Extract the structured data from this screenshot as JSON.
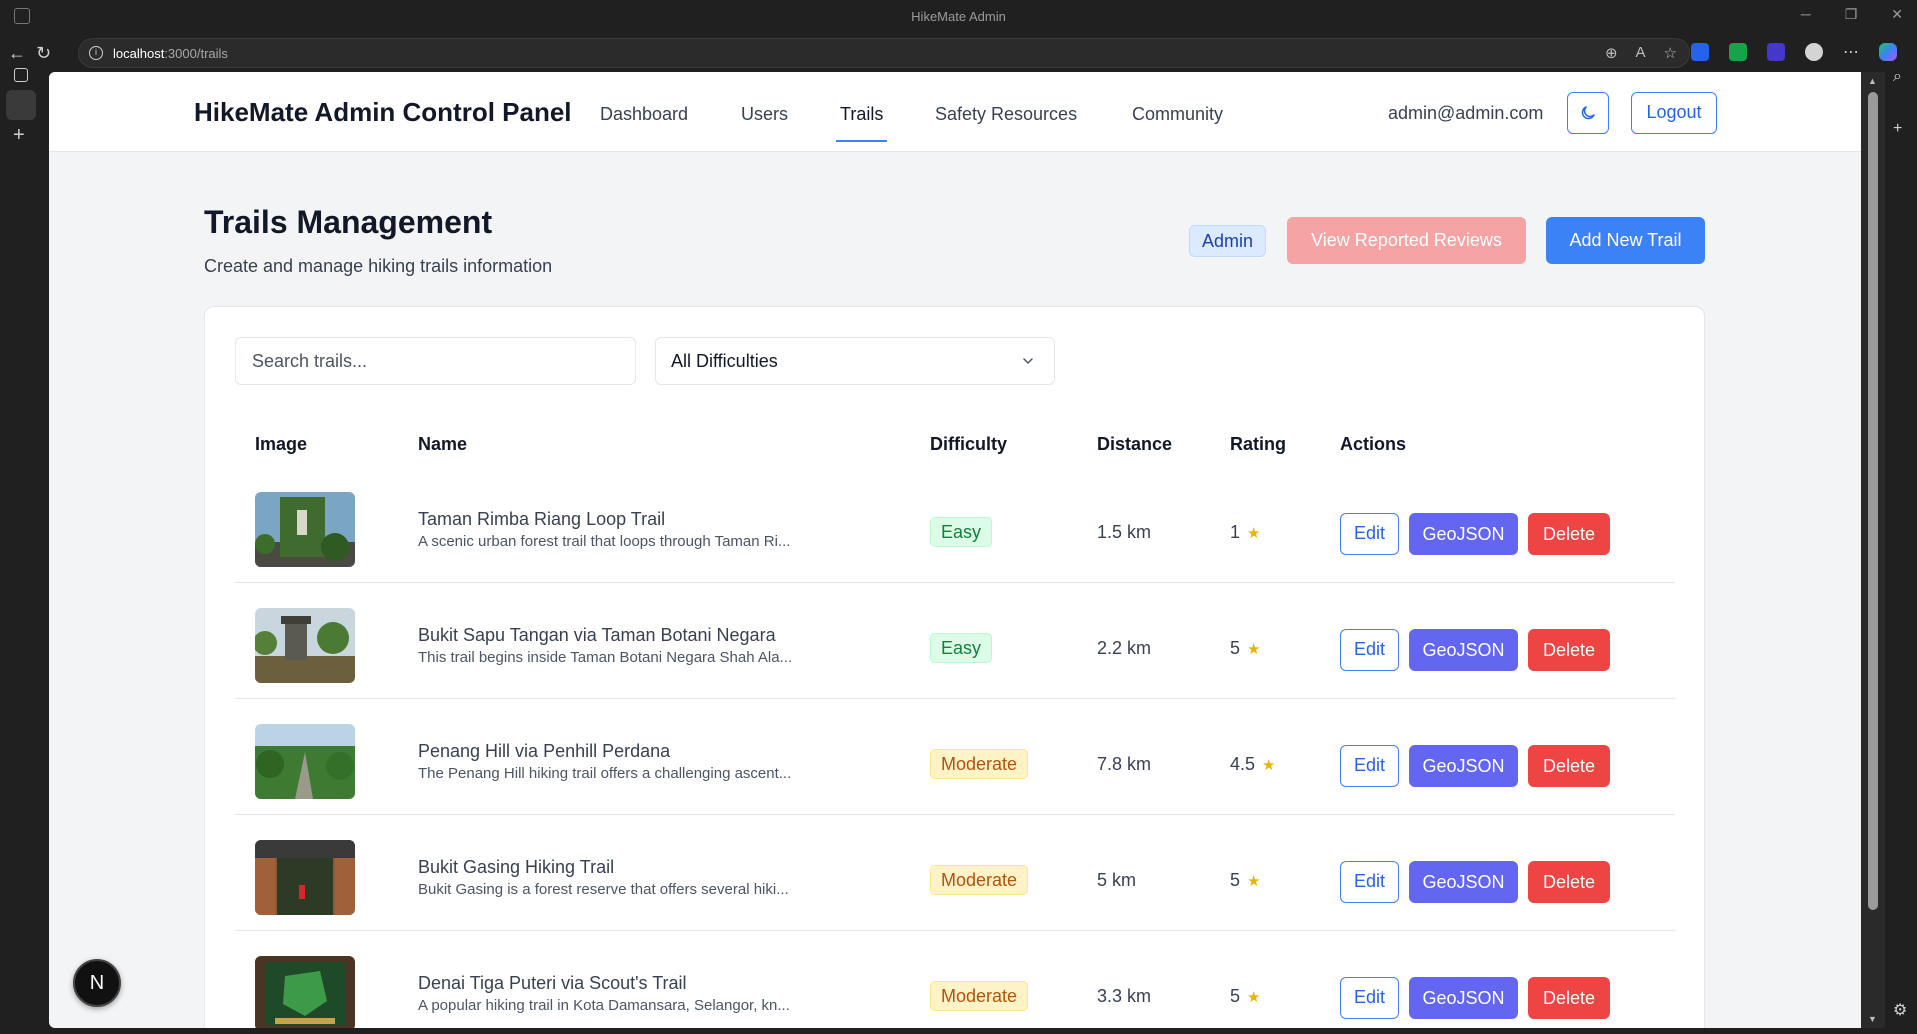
{
  "browser": {
    "window_title": "HikeMate Admin",
    "url_host": "localhost",
    "url_path": ":3000/trails"
  },
  "nav": {
    "brand": "HikeMate Admin Control Panel",
    "links": [
      "Dashboard",
      "Users",
      "Trails",
      "Safety Resources",
      "Community"
    ],
    "active": "Trails",
    "user_email": "admin@admin.com",
    "logout": "Logout"
  },
  "page": {
    "title": "Trails Management",
    "subtitle": "Create and manage hiking trails information",
    "role_badge": "Admin",
    "view_reported": "View Reported Reviews",
    "add_trail": "Add New Trail"
  },
  "filters": {
    "search_placeholder": "Search trails...",
    "difficulty_selected": "All Difficulties"
  },
  "table": {
    "headers": [
      "Image",
      "Name",
      "Difficulty",
      "Distance",
      "Rating",
      "Actions"
    ],
    "rows": [
      {
        "name": "Taman Rimba Riang Loop Trail",
        "desc": "A scenic urban forest trail that loops through Taman Ri...",
        "difficulty": "Easy",
        "distance": "1.5 km",
        "rating": "1"
      },
      {
        "name": "Bukit Sapu Tangan via Taman Botani Negara",
        "desc": "This trail begins inside Taman Botani Negara Shah Ala...",
        "difficulty": "Easy",
        "distance": "2.2 km",
        "rating": "5"
      },
      {
        "name": "Penang Hill via Penhill Perdana",
        "desc": "The Penang Hill hiking trail offers a challenging ascent...",
        "difficulty": "Moderate",
        "distance": "7.8 km",
        "rating": "4.5"
      },
      {
        "name": "Bukit Gasing Hiking Trail",
        "desc": "Bukit Gasing is a forest reserve that offers several hiki...",
        "difficulty": "Moderate",
        "distance": "5 km",
        "rating": "5"
      },
      {
        "name": "Denai Tiga Puteri via Scout's Trail",
        "desc": "A popular hiking trail in Kota Damansara, Selangor, kn...",
        "difficulty": "Moderate",
        "distance": "3.3 km",
        "rating": "5"
      }
    ],
    "action_labels": {
      "edit": "Edit",
      "geojson": "GeoJSON",
      "delete": "Delete"
    },
    "star": "★"
  },
  "next_badge": "N",
  "colors": {
    "primary": "#3b82f6",
    "geojson": "#6366f1",
    "delete": "#ef4444",
    "reported": "#f5a3a3",
    "easy": "#15803d",
    "moderate": "#b45309"
  }
}
